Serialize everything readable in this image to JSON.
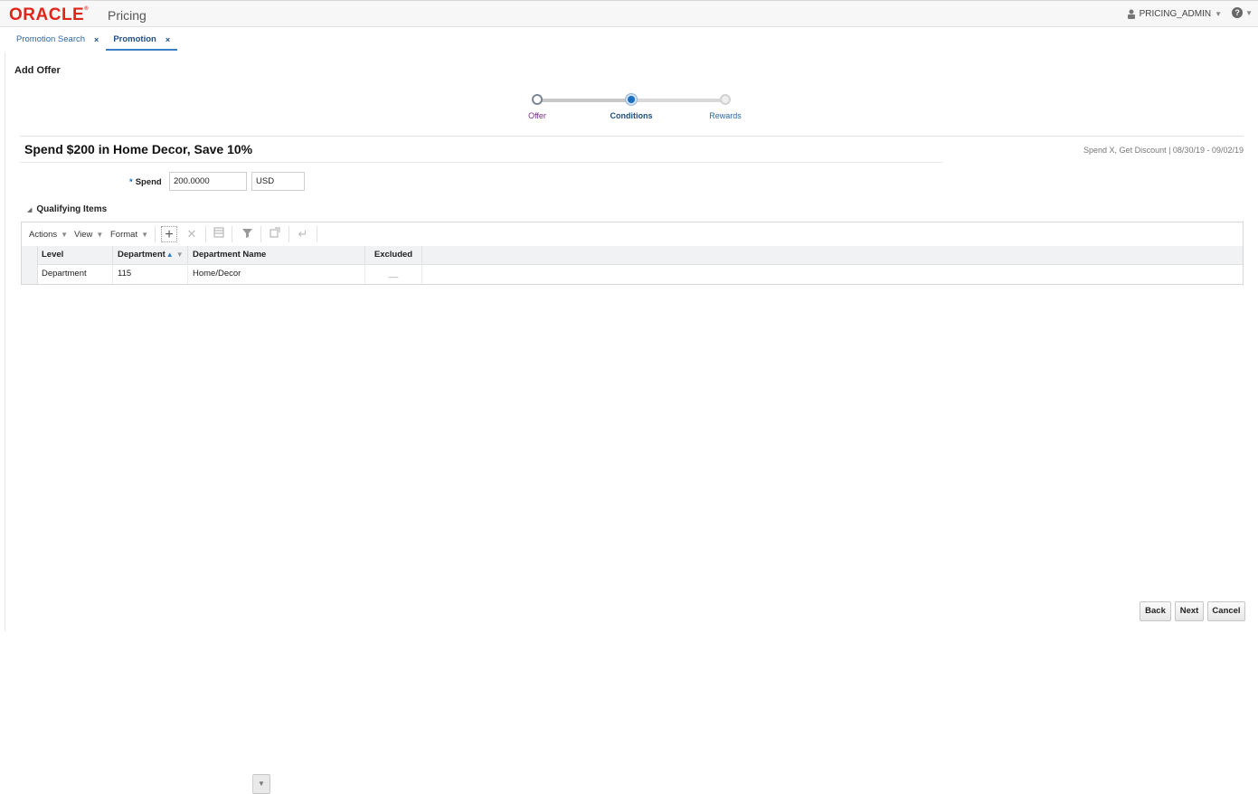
{
  "header": {
    "brand": "ORACLE",
    "brand_mark": "®",
    "app_name": "Pricing",
    "user": "PRICING_ADMIN"
  },
  "tabs": [
    {
      "label": "Promotion Search",
      "close": "×"
    },
    {
      "label": "Promotion",
      "close": "×"
    }
  ],
  "page": {
    "title": "Add Offer"
  },
  "train": {
    "steps": [
      {
        "label": "Offer",
        "state": "visited"
      },
      {
        "label": "Conditions",
        "state": "current"
      },
      {
        "label": "Rewards",
        "state": "future"
      }
    ]
  },
  "promotion": {
    "title": "Spend $200 in Home Decor, Save 10%",
    "meta": "Spend X, Get Discount  |  08/30/19 - 09/02/19"
  },
  "spend": {
    "required_mark": "*",
    "label": "Spend",
    "value": "200.0000",
    "currency": "USD"
  },
  "qualifying_items": {
    "title": "Qualifying Items",
    "menus": [
      "Actions",
      "View",
      "Format"
    ],
    "columns": [
      "Level",
      "Department",
      "Department Name",
      "Excluded"
    ],
    "rows": [
      {
        "level": "Department",
        "department": "115",
        "department_name": "Home/Decor",
        "excluded": "__"
      }
    ]
  },
  "footer": {
    "back": "Back",
    "next": "Next",
    "cancel": "Cancel"
  }
}
